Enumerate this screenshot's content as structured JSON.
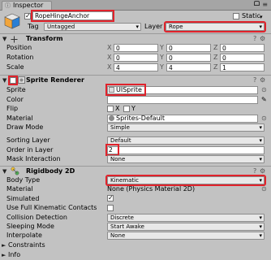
{
  "tab": {
    "label": "Inspector",
    "menu": "≡"
  },
  "header": {
    "active_checked": "✓",
    "name": "RopeHingeAnchor",
    "static_label": "Static",
    "tag_label": "Tag",
    "tag_value": "Untagged",
    "layer_label": "Layer",
    "layer_value": "Rope"
  },
  "transform": {
    "title": "Transform",
    "rows": [
      {
        "label": "Position",
        "x": "0",
        "y": "0",
        "z": "0"
      },
      {
        "label": "Rotation",
        "x": "0",
        "y": "0",
        "z": "0"
      },
      {
        "label": "Scale",
        "x": "4",
        "y": "4",
        "z": "1"
      }
    ],
    "axis": [
      "X",
      "Y",
      "Z"
    ]
  },
  "sprite_renderer": {
    "title": "Sprite Renderer",
    "sprite_label": "Sprite",
    "sprite_value": "UISprite",
    "color_label": "Color",
    "flip_label": "Flip",
    "flip_x": "X",
    "flip_y": "Y",
    "material_label": "Material",
    "material_value": "Sprites-Default",
    "draw_mode_label": "Draw Mode",
    "draw_mode_value": "Simple",
    "sorting_layer_label": "Sorting Layer",
    "sorting_layer_value": "Default",
    "order_label": "Order in Layer",
    "order_value": "2",
    "mask_label": "Mask Interaction",
    "mask_value": "None"
  },
  "rigidbody": {
    "title": "Rigidbody 2D",
    "body_type_label": "Body Type",
    "body_type_value": "Kinematic",
    "material_label": "Material",
    "material_value": "None (Physics Material 2D)",
    "simulated_label": "Simulated",
    "simulated_check": "✓",
    "full_kin_label": "Use Full Kinematic Contacts",
    "collision_label": "Collision Detection",
    "collision_value": "Discrete",
    "sleeping_label": "Sleeping Mode",
    "sleeping_value": "Start Awake",
    "interpolate_label": "Interpolate",
    "interpolate_value": "None",
    "constraints_label": "Constraints",
    "info_label": "Info"
  },
  "colors": {
    "highlight": "#e0222b",
    "panel": "#c2c2c2"
  }
}
